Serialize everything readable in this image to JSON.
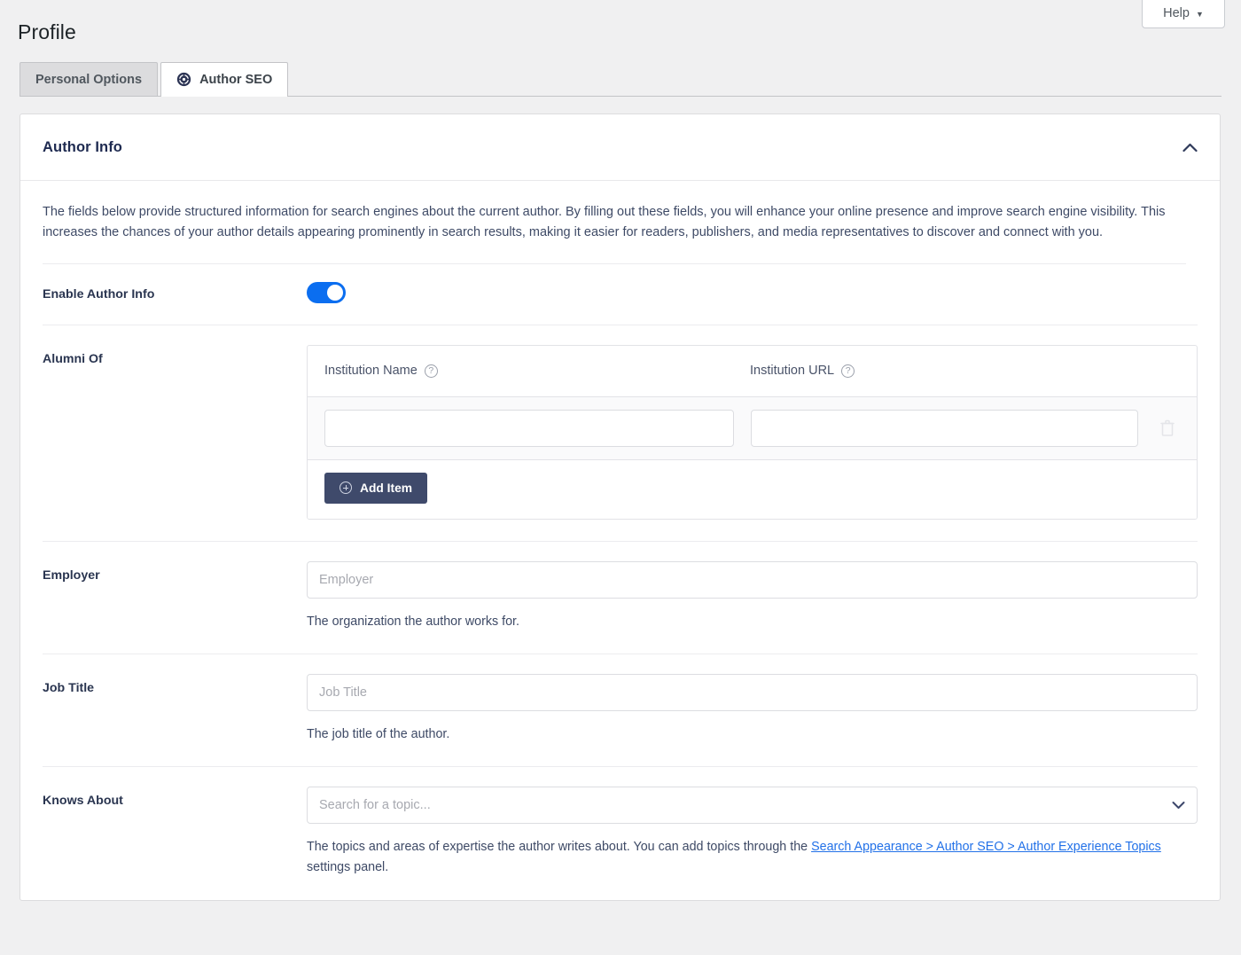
{
  "header": {
    "help_label": "Help",
    "help_caret": "▼",
    "page_title": "Profile"
  },
  "tabs": [
    {
      "label": "Personal Options",
      "icon": "",
      "active": false
    },
    {
      "label": "Author SEO",
      "icon": "rank-math-logo-icon",
      "active": true
    }
  ],
  "panel": {
    "title": "Author Info",
    "collapse_icon": "chevron-up-icon",
    "intro": "The fields below provide structured information for search engines about the current author. By filling out these fields, you will enhance your online presence and improve search engine visibility. This increases the chances of your author details appearing prominently in search results, making it easier for readers, publishers, and media representatives to discover and connect with you."
  },
  "fields": {
    "enable_author_info": {
      "label": "Enable Author Info",
      "toggle_on": true
    },
    "alumni_of": {
      "label": "Alumni Of",
      "columns": [
        {
          "label": "Institution Name",
          "help_icon": "question-mark-icon"
        },
        {
          "label": "Institution URL",
          "help_icon": "question-mark-icon"
        }
      ],
      "rows": [
        {
          "institution_name": "",
          "institution_url": ""
        }
      ],
      "delete_icon": "trash-icon",
      "add_item_label": "Add Item",
      "add_item_icon": "plus-circle-icon"
    },
    "employer": {
      "label": "Employer",
      "value": "",
      "placeholder": "Employer",
      "description": "The organization the author works for."
    },
    "job_title": {
      "label": "Job Title",
      "value": "",
      "placeholder": "Job Title",
      "description": "The job title of the author."
    },
    "knows_about": {
      "label": "Knows About",
      "value": "",
      "placeholder": "Search for a topic...",
      "chevron_icon": "chevron-down-icon",
      "description_before": "The topics and areas of expertise the author writes about. You can add topics through the ",
      "link_text": "Search Appearance > Author SEO > Author Experience Topics",
      "description_after": " settings panel."
    }
  },
  "colors": {
    "page_bg": "#f0f0f1",
    "accent_blue": "#0b6ef0",
    "link_blue": "#2271e8",
    "dark_navy": "#3f4a6b",
    "heading": "#1e2a50"
  }
}
